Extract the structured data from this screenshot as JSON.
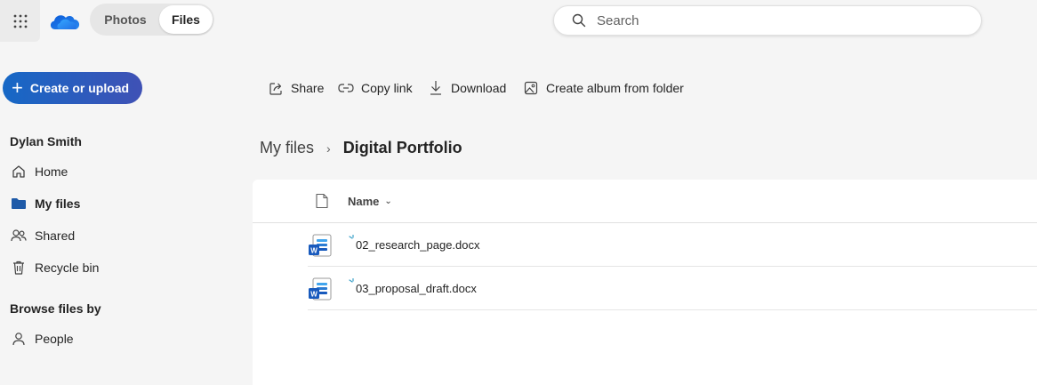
{
  "header": {
    "tabs": [
      {
        "label": "Photos",
        "selected": false
      },
      {
        "label": "Files",
        "selected": true
      }
    ],
    "search_placeholder": "Search"
  },
  "sidebar": {
    "create_label": "Create or upload",
    "user_name": "Dylan Smith",
    "items": [
      {
        "label": "Home",
        "icon": "home-icon"
      },
      {
        "label": "My files",
        "icon": "folder-icon",
        "active": true
      },
      {
        "label": "Shared",
        "icon": "people-icon"
      },
      {
        "label": "Recycle bin",
        "icon": "trash-icon"
      }
    ],
    "browse_heading": "Browse files by",
    "browse_items": [
      {
        "label": "People",
        "icon": "person-icon"
      }
    ]
  },
  "toolbar": {
    "share": "Share",
    "copy_link": "Copy link",
    "download": "Download",
    "create_album": "Create album from folder"
  },
  "breadcrumb": {
    "root": "My files",
    "current": "Digital Portfolio"
  },
  "file_list": {
    "column_name": "Name",
    "files": [
      {
        "name": "02_research_page.docx",
        "type": "word"
      },
      {
        "name": "03_proposal_draft.docx",
        "type": "word"
      }
    ]
  },
  "colors": {
    "accent": "#1668c6",
    "accent_end": "#3f51b5",
    "folder": "#1e5aa8"
  }
}
